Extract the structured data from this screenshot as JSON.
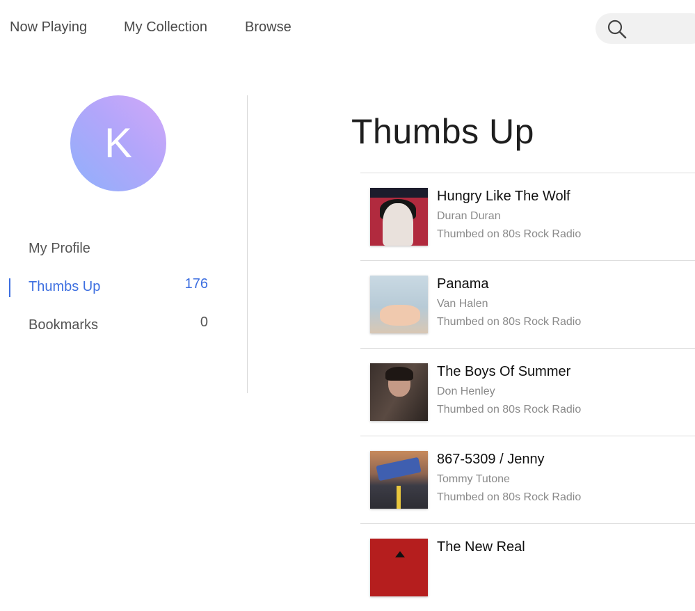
{
  "nav": {
    "items": [
      "Now Playing",
      "My Collection",
      "Browse"
    ]
  },
  "search": {
    "icon": "search-icon"
  },
  "profile": {
    "avatar_initial": "K",
    "menu": [
      {
        "label": "My Profile",
        "count": ""
      },
      {
        "label": "Thumbs Up",
        "count": "176"
      },
      {
        "label": "Bookmarks",
        "count": "0"
      }
    ]
  },
  "main": {
    "title": "Thumbs Up",
    "tracks": [
      {
        "title": "Hungry Like The Wolf",
        "artist": "Duran Duran",
        "thumbed": "Thumbed on 80s Rock Radio"
      },
      {
        "title": "Panama",
        "artist": "Van Halen",
        "thumbed": "Thumbed on 80s Rock Radio"
      },
      {
        "title": "The Boys Of Summer",
        "artist": "Don Henley",
        "thumbed": "Thumbed on 80s Rock Radio"
      },
      {
        "title": "867-5309 / Jenny",
        "artist": "Tommy Tutone",
        "thumbed": "Thumbed on 80s Rock Radio"
      },
      {
        "title": "The New Real",
        "artist": "",
        "thumbed": ""
      }
    ]
  },
  "colors": {
    "accent": "#3c6ee0",
    "text_muted": "#8a8a8a",
    "search_bg": "#f1f1f1"
  }
}
